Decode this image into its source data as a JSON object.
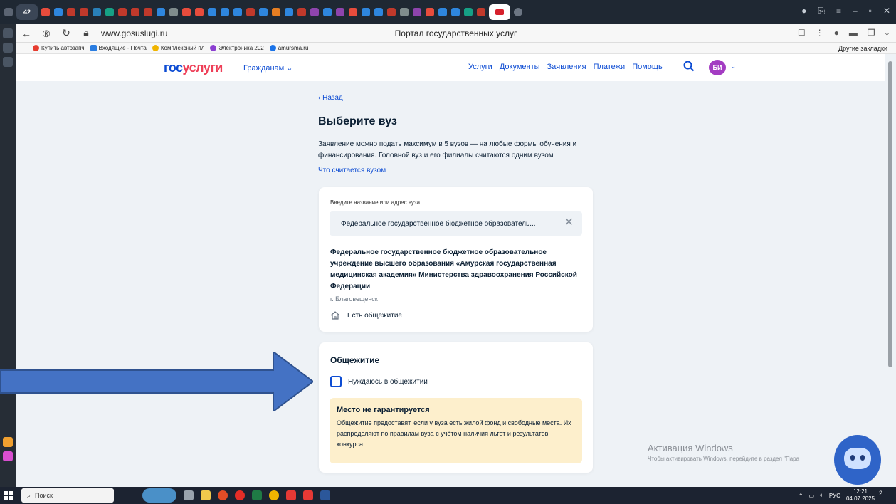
{
  "browser": {
    "tab_count": "42",
    "url": "www.gosuslugi.ru",
    "page_title": "Портал государственных услуг",
    "bookmarks": [
      {
        "label": "Купить автозапч",
        "color": "#e63c2f"
      },
      {
        "label": "Входящие - Почта",
        "color": "#2a7de1"
      },
      {
        "label": "Комплексный пл",
        "color": "#f0b400"
      },
      {
        "label": "Электроника 202",
        "color": "#8b3fd1"
      },
      {
        "label": "amursma.ru",
        "color": "#1a73e8"
      }
    ],
    "other_bookmarks": "Другие закладки"
  },
  "header": {
    "logo_part1": "гос",
    "logo_part2": "услуги",
    "audience": "Гражданам",
    "nav": [
      "Услуги",
      "Документы",
      "Заявления",
      "Платежи",
      "Помощь"
    ],
    "avatar_initials": "БИ"
  },
  "main": {
    "back": "Назад",
    "title": "Выберите вуз",
    "description": "Заявление можно подать максимум в 5 вузов — на любые формы обучения и финансирования. Головной вуз и его филиалы считаются одним вузом",
    "what_is_university_link": "Что считается вузом"
  },
  "search_card": {
    "label": "Введите название или адрес вуза",
    "value": "Федеральное государственное бюджетное образователь...",
    "university_name": "Федеральное государственное бюджетное образовательное учреждение высшего образования «Амурская государственная медицинская академия» Министерства здравоохранения Российской Федерации",
    "city": "г. Благовещенск",
    "dorm_available": "Есть общежитие"
  },
  "dorm_card": {
    "title": "Общежитие",
    "checkbox_label": "Нуждаюсь в общежитии",
    "checkbox_checked": false,
    "note_title": "Место не гарантируется",
    "note_text": "Общежитие предоставят, если у вуза есть жилой фонд и свободные места. Их распределяют по правилам вуза с учётом наличия льгот и результатов конкурса"
  },
  "windows": {
    "activation_title": "Активация Windows",
    "activation_text": "Чтобы активировать Windows, перейдите в раздел \"Пара",
    "search_placeholder": "Поиск",
    "lang": "РУС",
    "time": "12:21",
    "date": "04.07.2025",
    "notifications": "2"
  }
}
